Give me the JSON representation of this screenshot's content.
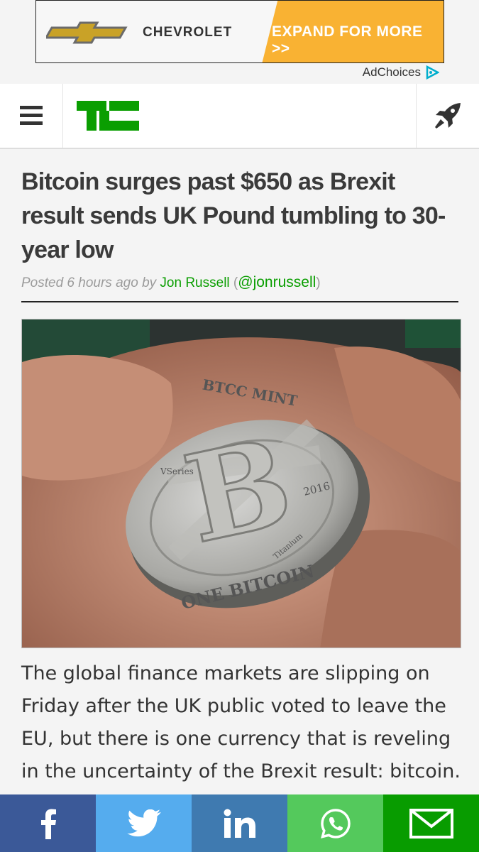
{
  "ad": {
    "brand": "CHEVROLET",
    "cta": "EXPAND FOR MORE >>",
    "adchoices": "AdChoices",
    "colors": {
      "accent": "#f9b233",
      "gold": "#c9a227"
    }
  },
  "header": {
    "logo_icon": "techcrunch-tc-logo",
    "menu_icon": "hamburger-menu-icon",
    "action_icon": "rocket-icon",
    "colors": {
      "logo": "#0a9e01"
    }
  },
  "article": {
    "title": "Bitcoin surges past $650 as Brexit result sends UK Pound tumbling to 30-year low",
    "byline": {
      "posted": "Posted 6 hours ago by",
      "author": "Jon Russell",
      "open_paren": "(",
      "handle": "@jonrussell",
      "close_paren": ")"
    },
    "image": {
      "coin_top": "BTCC MINT",
      "coin_bottom": "ONE BITCOIN",
      "coin_series": "VSeries",
      "coin_year": "2016",
      "coin_metal": "Titanium"
    },
    "body": "The global finance markets are slipping on Friday after the UK public voted to leave the EU, but there is one currency that is reveling in the uncertainty of the Brexit result: bitcoin."
  },
  "share": {
    "buttons": [
      {
        "icon": "facebook-icon",
        "color": "#3b5998"
      },
      {
        "icon": "twitter-icon",
        "color": "#55acee"
      },
      {
        "icon": "linkedin-icon",
        "color": "#3f7ab0"
      },
      {
        "icon": "whatsapp-icon",
        "color": "#54c95c"
      },
      {
        "icon": "email-icon",
        "color": "#089c00"
      }
    ]
  }
}
